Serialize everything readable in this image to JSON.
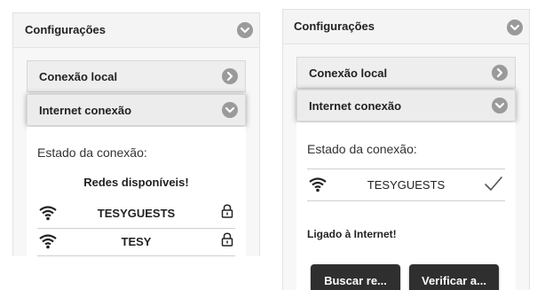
{
  "left": {
    "settings_title": "Configurações",
    "local_connection_label": "Conexão local",
    "internet_connection_label": "Internet conexão",
    "connection_status_label": "Estado da conexão:",
    "available_networks_title": "Redes disponíveis!",
    "networks": [
      {
        "name": "TESYGUESTS",
        "icon": "wifi-icon",
        "secured": true
      },
      {
        "name": "TESY",
        "icon": "wifi-icon",
        "secured": true
      }
    ]
  },
  "right": {
    "settings_title": "Configurações",
    "local_connection_label": "Conexão local",
    "internet_connection_label": "Internet conexão",
    "connection_status_label": "Estado da conexão:",
    "connected_network": {
      "name": "TESYGUESTS",
      "icon": "wifi-icon",
      "status_icon": "checkmark-icon"
    },
    "connected_message": "Ligado à Internet!",
    "search_button_label": "Buscar re...",
    "verify_button_label": "Verificar a..."
  },
  "colors": {
    "panel_background": "#f7f7f7",
    "header_icon": "#9a9a9a",
    "button_background": "#2f2f2f",
    "button_text": "#ffffff"
  }
}
